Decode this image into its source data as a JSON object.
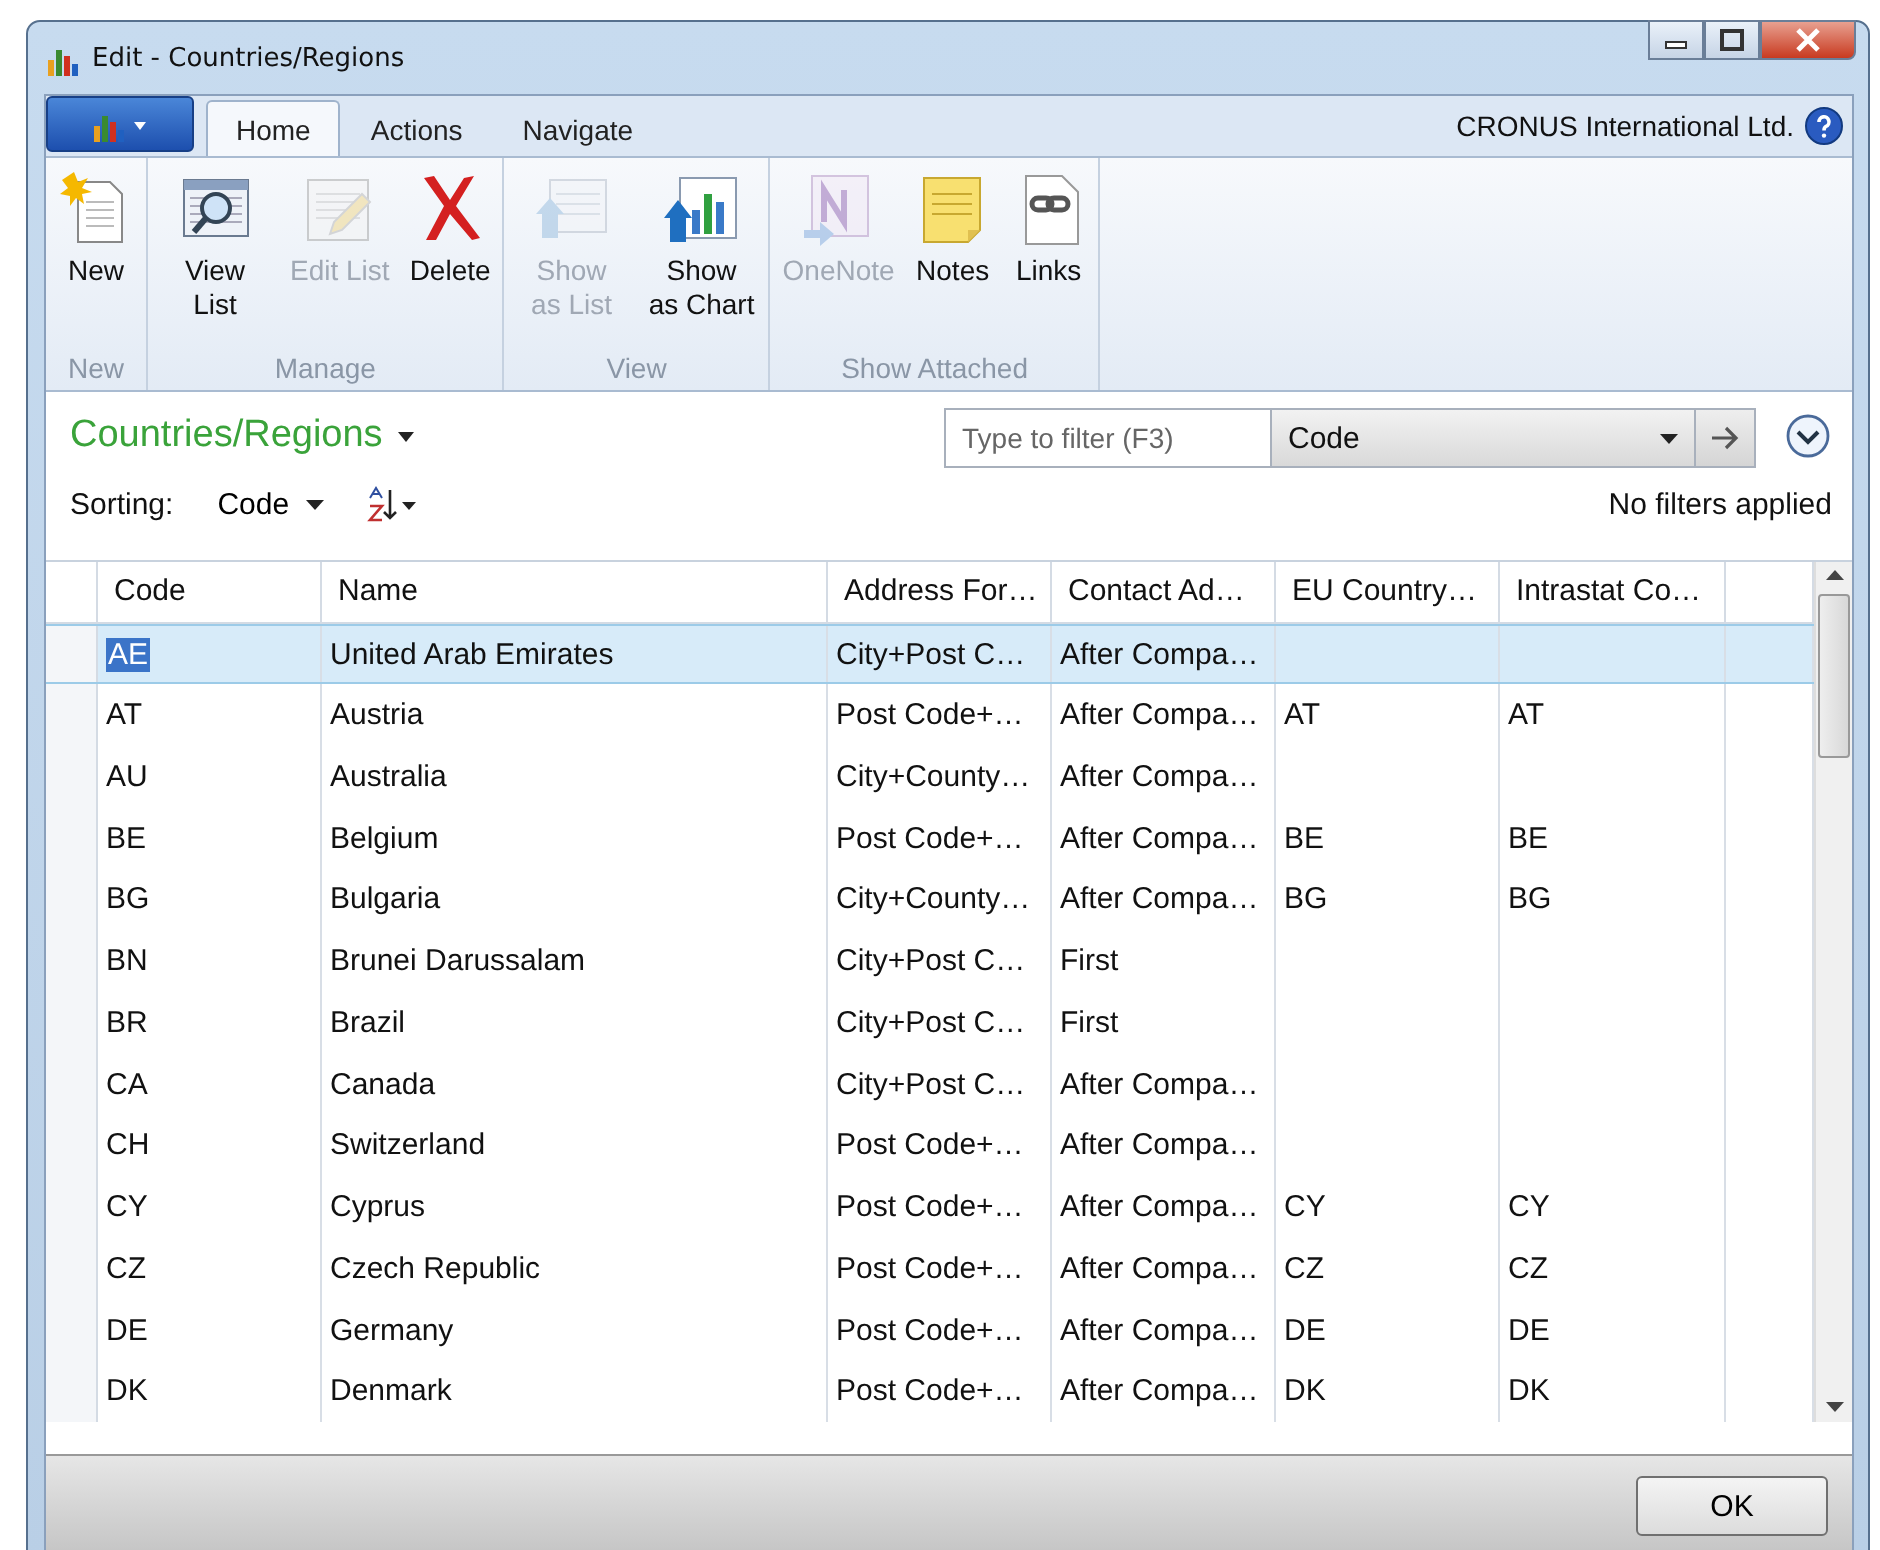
{
  "window": {
    "title": "Edit - Countries/Regions",
    "controls": [
      {
        "kind": "minimize"
      },
      {
        "kind": "maximize"
      },
      {
        "kind": "close"
      }
    ]
  },
  "ribbon": {
    "tabs": [
      {
        "label": "Home",
        "selected": true
      },
      {
        "label": "Actions",
        "selected": false
      },
      {
        "label": "Navigate",
        "selected": false
      }
    ],
    "company": "CRONUS International Ltd.",
    "groups": [
      {
        "label": "New",
        "buttons": [
          {
            "label": "New",
            "kind": "new",
            "disabled": false
          }
        ]
      },
      {
        "label": "Manage",
        "buttons": [
          {
            "label": "View List",
            "kind": "view",
            "disabled": false
          },
          {
            "label": "Edit List",
            "kind": "edit",
            "disabled": true
          },
          {
            "label": "Delete",
            "kind": "delete",
            "disabled": false
          }
        ]
      },
      {
        "label": "View",
        "buttons": [
          {
            "label": "Show as List",
            "kind": "list",
            "disabled": true
          },
          {
            "label": "Show as Chart",
            "kind": "chart",
            "disabled": false
          }
        ]
      },
      {
        "label": "Show Attached",
        "buttons": [
          {
            "label": "OneNote",
            "kind": "onenote",
            "disabled": true
          },
          {
            "label": "Notes",
            "kind": "notes",
            "disabled": false
          },
          {
            "label": "Links",
            "kind": "links",
            "disabled": false
          }
        ]
      }
    ]
  },
  "page": {
    "title": "Countries/Regions",
    "filter": {
      "placeholder": "Type to filter (F3)",
      "field": "Code"
    },
    "sorting_label": "Sorting:",
    "sort_field": "Code",
    "filter_status": "No filters applied"
  },
  "table": {
    "columns": [
      "Code",
      "Name",
      "Address For…",
      "Contact Ad…",
      "EU Country…",
      "Intrastat Co…"
    ],
    "rows": [
      {
        "cells": [
          "AE",
          "United Arab Emirates",
          "City+Post C…",
          "After Compa…",
          "",
          ""
        ],
        "selected": true
      },
      {
        "cells": [
          "AT",
          "Austria",
          "Post Code+…",
          "After Compa…",
          "AT",
          "AT"
        ],
        "selected": false
      },
      {
        "cells": [
          "AU",
          "Australia",
          "City+County…",
          "After Compa…",
          "",
          ""
        ],
        "selected": false
      },
      {
        "cells": [
          "BE",
          "Belgium",
          "Post Code+…",
          "After Compa…",
          "BE",
          "BE"
        ],
        "selected": false
      },
      {
        "cells": [
          "BG",
          "Bulgaria",
          "City+County…",
          "After Compa…",
          "BG",
          "BG"
        ],
        "selected": false
      },
      {
        "cells": [
          "BN",
          "Brunei Darussalam",
          "City+Post C…",
          "First",
          "",
          ""
        ],
        "selected": false
      },
      {
        "cells": [
          "BR",
          "Brazil",
          "City+Post C…",
          "First",
          "",
          ""
        ],
        "selected": false
      },
      {
        "cells": [
          "CA",
          "Canada",
          "City+Post C…",
          "After Compa…",
          "",
          ""
        ],
        "selected": false
      },
      {
        "cells": [
          "CH",
          "Switzerland",
          "Post Code+…",
          "After Compa…",
          "",
          ""
        ],
        "selected": false
      },
      {
        "cells": [
          "CY",
          "Cyprus",
          "Post Code+…",
          "After Compa…",
          "CY",
          "CY"
        ],
        "selected": false
      },
      {
        "cells": [
          "CZ",
          "Czech Republic",
          "Post Code+…",
          "After Compa…",
          "CZ",
          "CZ"
        ],
        "selected": false
      },
      {
        "cells": [
          "DE",
          "Germany",
          "Post Code+…",
          "After Compa…",
          "DE",
          "DE"
        ],
        "selected": false
      },
      {
        "cells": [
          "DK",
          "Denmark",
          "Post Code+…",
          "After Compa…",
          "DK",
          "DK"
        ],
        "selected": false
      }
    ]
  },
  "footer": {
    "buttons": [
      "OK"
    ]
  }
}
